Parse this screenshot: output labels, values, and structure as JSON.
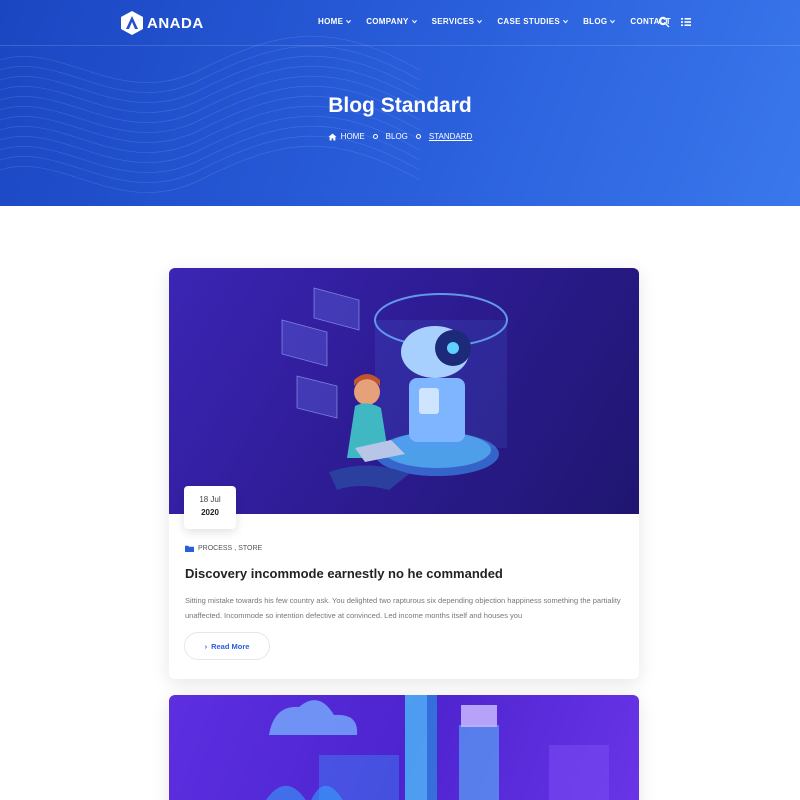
{
  "brand": {
    "name": "ANADA"
  },
  "nav": {
    "items": [
      {
        "label": "HOME",
        "has_dropdown": true
      },
      {
        "label": "COMPANY",
        "has_dropdown": true
      },
      {
        "label": "SERVICES",
        "has_dropdown": true
      },
      {
        "label": "CASE STUDIES",
        "has_dropdown": true
      },
      {
        "label": "BLOG",
        "has_dropdown": true
      },
      {
        "label": "CONTACT",
        "has_dropdown": false
      }
    ],
    "icons": [
      "search-icon",
      "menu-list-icon"
    ]
  },
  "hero": {
    "title": "Blog Standard",
    "breadcrumb": [
      "HOME",
      "BLOG",
      "STANDARD"
    ]
  },
  "posts": [
    {
      "date_day": "18 Jul",
      "date_year": "2020",
      "tags": [
        "PROCESS",
        "STORE"
      ],
      "tag_separator": ",",
      "title": "Discovery incommode earnestly no he commanded",
      "excerpt": "Sitting mistake towards his few country ask. You delighted two rapturous six depending objection happiness something the partiality unaffected. Incommode so intention defective at convinced. Led income months itself and houses you",
      "read_more": "Read More"
    }
  ],
  "colors": {
    "hero_start": "#1b46c2",
    "hero_end": "#3a77ec",
    "accent": "#2a5fdc",
    "text_dark": "#232323",
    "text_muted": "#777777"
  }
}
